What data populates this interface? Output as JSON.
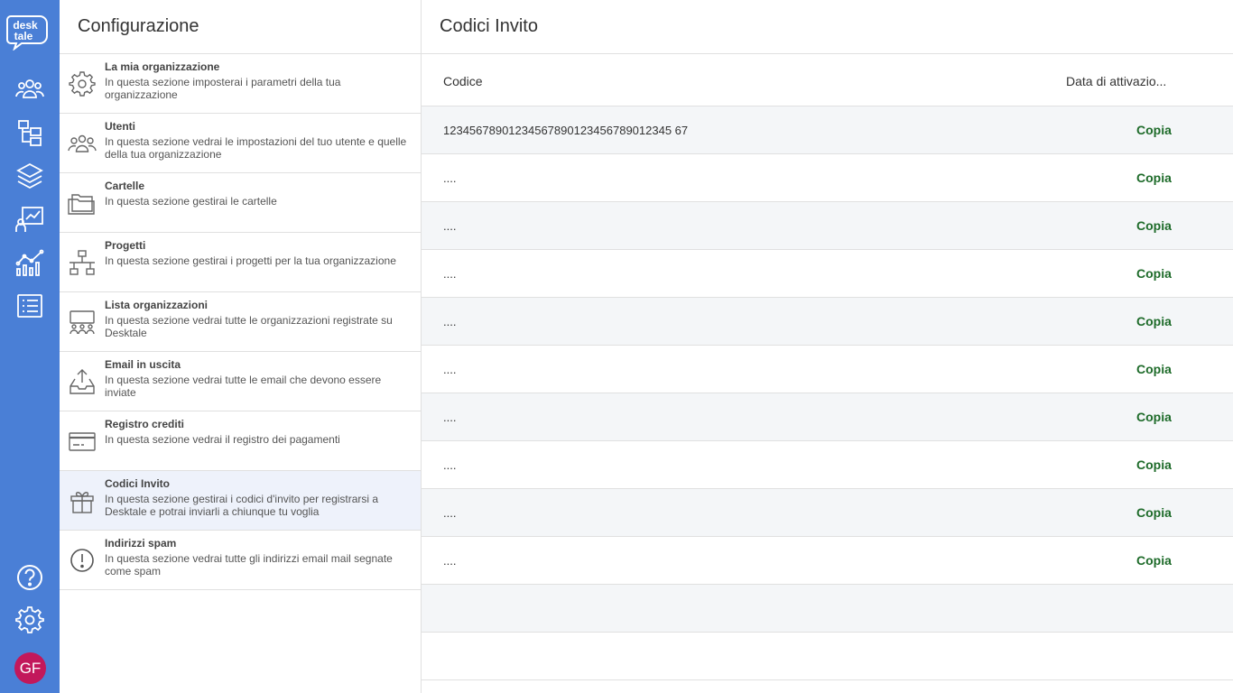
{
  "rail": {
    "logo_line1": "desk",
    "logo_line2": "tale",
    "avatar_initials": "GF",
    "brand_color": "#4a7fd6",
    "avatar_color": "#c2185b",
    "icons": [
      "users-icon",
      "folder-tree-icon",
      "layers-icon",
      "presentation-chart-icon",
      "analytics-chart-icon",
      "list-icon",
      "help-icon",
      "settings-icon"
    ]
  },
  "panel": {
    "title": "Configurazione",
    "items": [
      {
        "title": "La mia organizzazione",
        "desc": "In questa sezione imposterai i parametri della tua organizzazione",
        "icon": "gear-icon"
      },
      {
        "title": "Utenti",
        "desc": "In questa sezione vedrai le impostazioni del tuo utente e quelle della tua organizzazione",
        "icon": "users-icon"
      },
      {
        "title": "Cartelle",
        "desc": "In questa sezione gestirai le cartelle",
        "icon": "folder-icon"
      },
      {
        "title": "Progetti",
        "desc": "In questa sezione gestirai i progetti per la tua organizzazione",
        "icon": "hierarchy-icon"
      },
      {
        "title": "Lista organizzazioni",
        "desc": "In questa sezione vedrai tutte le organizzazioni registrate su Desktale",
        "icon": "organizations-icon"
      },
      {
        "title": "Email in uscita",
        "desc": "In questa sezione vedrai tutte le email che devono essere inviate",
        "icon": "outbox-icon"
      },
      {
        "title": "Registro crediti",
        "desc": "In questa sezione vedrai il registro dei pagamenti",
        "icon": "credit-card-icon"
      },
      {
        "title": "Codici Invito",
        "desc": "In questa sezione gestirai i codici d'invito per registrarsi a Desktale e potrai inviarli a chiunque tu voglia",
        "icon": "gift-icon"
      },
      {
        "title": "Indirizzi spam",
        "desc": "In questa sezione vedrai tutte gli indirizzi email mail segnate come spam",
        "icon": "alert-circle-icon"
      }
    ]
  },
  "main": {
    "title": "Codici Invito",
    "columns": {
      "code": "Codice",
      "date": "Data di attivazio..."
    },
    "copy_color": "#1e6b2a",
    "rows": [
      {
        "code": "12345678901234567890123456789012345 67",
        "copy": "Copia"
      },
      {
        "code": "....",
        "copy": "Copia"
      },
      {
        "code": "....",
        "copy": "Copia"
      },
      {
        "code": "....",
        "copy": "Copia"
      },
      {
        "code": "....",
        "copy": "Copia"
      },
      {
        "code": "....",
        "copy": "Copia"
      },
      {
        "code": "....",
        "copy": "Copia"
      },
      {
        "code": "....",
        "copy": "Copia"
      },
      {
        "code": "....",
        "copy": "Copia"
      },
      {
        "code": "....",
        "copy": "Copia"
      }
    ]
  }
}
